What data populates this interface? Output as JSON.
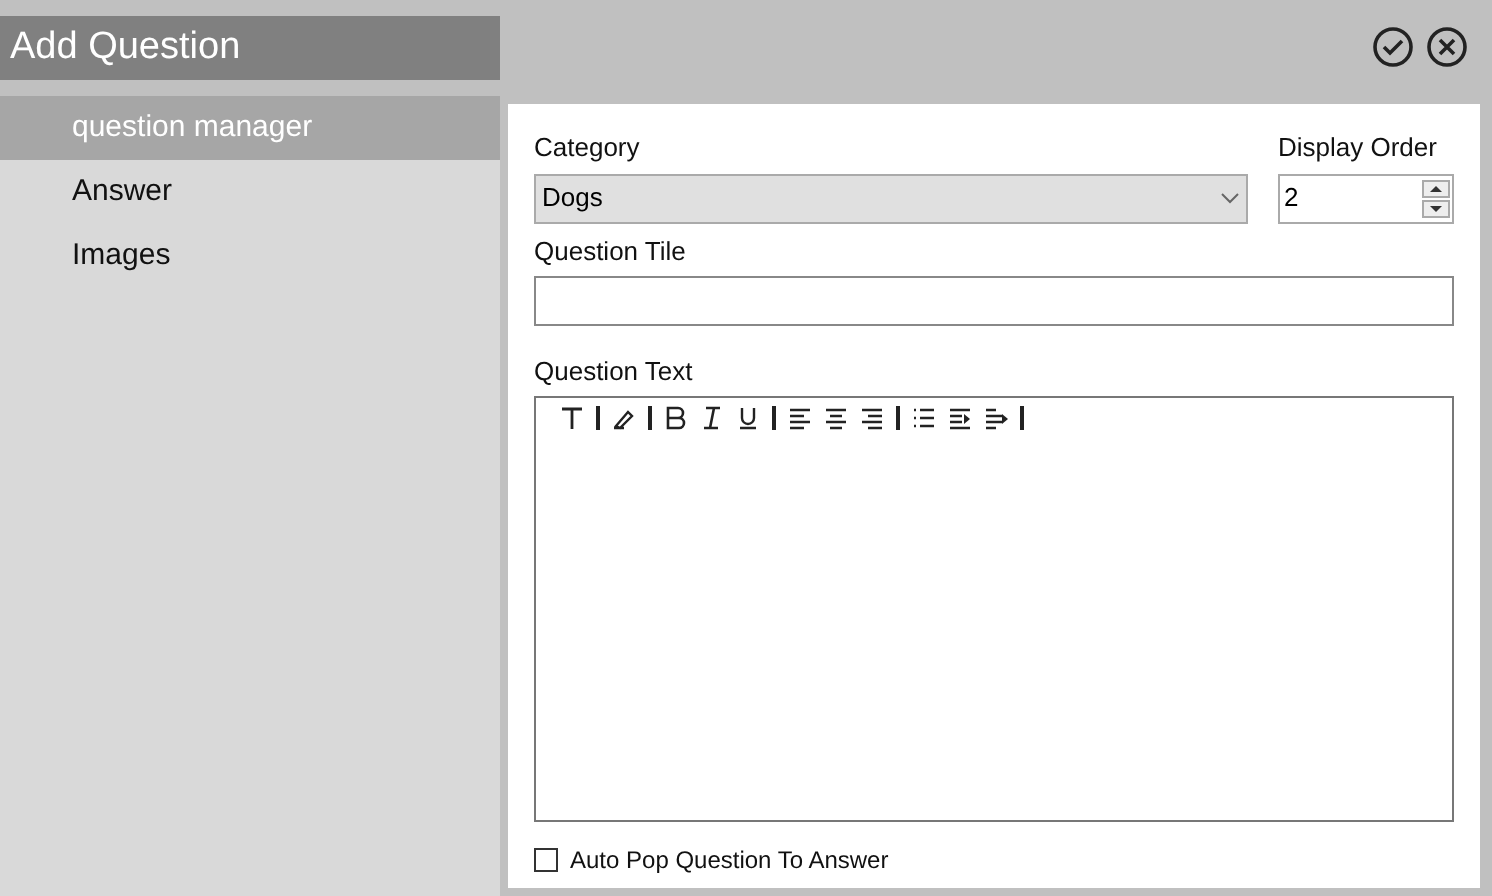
{
  "window": {
    "title": "Add Question"
  },
  "sidebar": {
    "items": [
      {
        "label": "question manager",
        "selected": true
      },
      {
        "label": "Answer",
        "selected": false
      },
      {
        "label": "Images",
        "selected": false
      }
    ]
  },
  "form": {
    "category": {
      "label": "Category",
      "value": "Dogs"
    },
    "display_order": {
      "label": "Display Order",
      "value": "2"
    },
    "question_title": {
      "label": "Question Tile"
    },
    "question_text": {
      "label": "Question Text"
    },
    "auto_pop": {
      "label": "Auto Pop Question To Answer",
      "checked": false
    }
  }
}
